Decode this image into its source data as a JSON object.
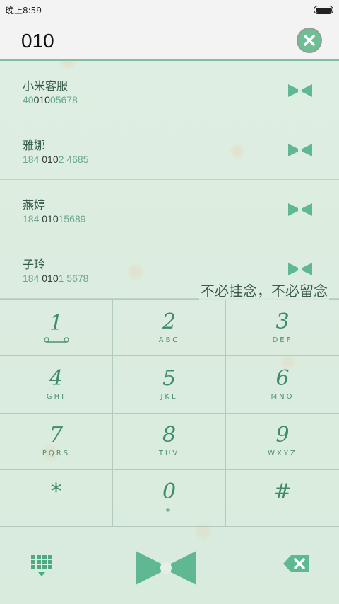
{
  "status_bar": {
    "time": "晚上8:59",
    "battery_icon": "battery-full-icon"
  },
  "header": {
    "dialed_number": "010",
    "clear_icon": "close-icon"
  },
  "contacts": [
    {
      "name": "小米客服",
      "number_prefix": "40",
      "number_match": "010",
      "number_suffix": "05678"
    },
    {
      "name": "雅娜",
      "number_prefix": "184 ",
      "number_match": "010",
      "number_suffix": "2 4685"
    },
    {
      "name": "燕婷",
      "number_prefix": "184 ",
      "number_match": "010",
      "number_suffix": "15689"
    },
    {
      "name": "子玲",
      "number_prefix": "184 ",
      "number_match": "010",
      "number_suffix": "1 5678"
    }
  ],
  "slogan": "不必挂念，不必留念",
  "keypad": [
    {
      "digit": "1",
      "letters": ""
    },
    {
      "digit": "2",
      "letters": "ABC"
    },
    {
      "digit": "3",
      "letters": "DEF"
    },
    {
      "digit": "4",
      "letters": "GHI"
    },
    {
      "digit": "5",
      "letters": "JKL"
    },
    {
      "digit": "6",
      "letters": "MNO"
    },
    {
      "digit": "7",
      "letters": "PQRS"
    },
    {
      "digit": "8",
      "letters": "TUV"
    },
    {
      "digit": "9",
      "letters": "WXYZ"
    },
    {
      "digit": "*",
      "letters": ""
    },
    {
      "digit": "0",
      "letters": "+"
    },
    {
      "digit": "#",
      "letters": ""
    }
  ],
  "bottom_bar": {
    "dialpad_icon": "dialpad-grid-icon",
    "call_icon": "bow-tie-call-icon",
    "backspace_icon": "backspace-icon"
  },
  "colors": {
    "accent": "#6fbf95",
    "highlight_text": "#2c3d36",
    "number_text": "#6aa88c"
  }
}
